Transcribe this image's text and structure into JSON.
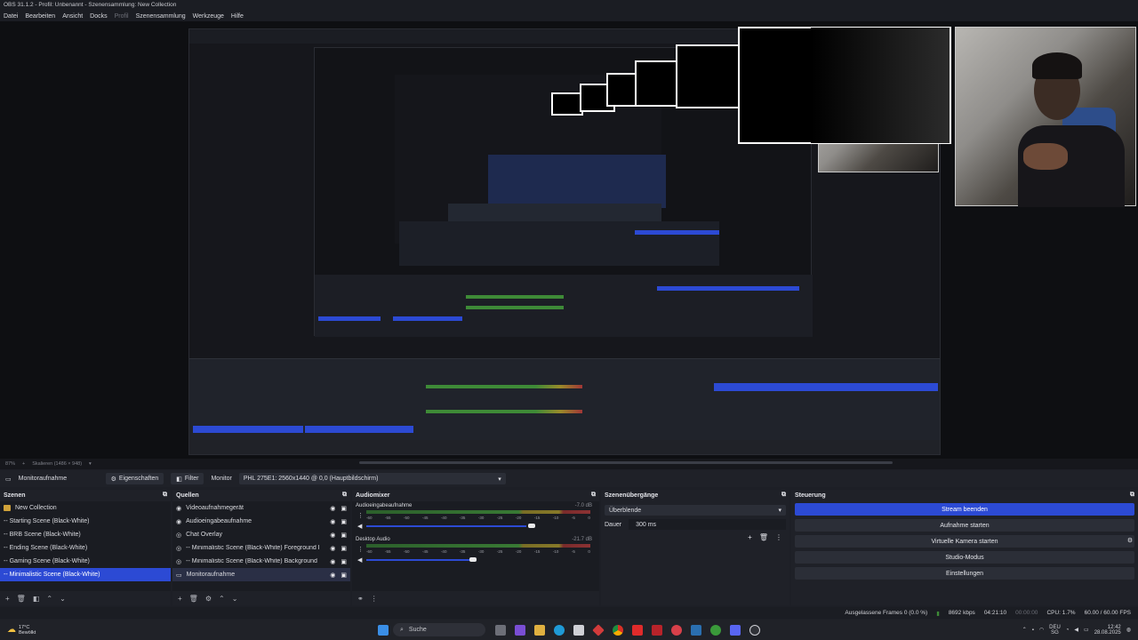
{
  "window": {
    "title": "OBS 31.1.2 - Profil: Unbenannt - Szenensammlung: New Collection"
  },
  "menu": {
    "items": [
      {
        "label": "Datei"
      },
      {
        "label": "Bearbeiten"
      },
      {
        "label": "Ansicht"
      },
      {
        "label": "Docks"
      },
      {
        "label": "Profil",
        "disabled": true
      },
      {
        "label": "Szenensammlung"
      },
      {
        "label": "Werkzeuge"
      },
      {
        "label": "Hilfe"
      }
    ]
  },
  "preview_status": {
    "zoom": "87%",
    "scale": "Skalieren (1486 × 948)"
  },
  "context_bar": {
    "source_name": "Monitoraufnahme",
    "properties_label": "Eigenschaften",
    "filter_label": "Filter",
    "monitor_label": "Monitor",
    "monitor_value": "PHL 275E1: 2560x1440 @ 0,0 (Hauptbildschirm)"
  },
  "scenes": {
    "title": "Szenen",
    "items": [
      {
        "label": "New Collection",
        "folder": true
      },
      {
        "label": "-- Starting Scene (Black-White)"
      },
      {
        "label": "-- BRB Scene (Black-White)"
      },
      {
        "label": "-- Ending Scene (Black-White)"
      },
      {
        "label": "-- Gaming Scene (Black-White)"
      },
      {
        "label": "-- Minimalistic Scene (Black-White)",
        "selected": true
      }
    ]
  },
  "sources": {
    "title": "Quellen",
    "items": [
      {
        "label": "Videoaufnahmegerät",
        "icon": "camera-icon"
      },
      {
        "label": "Audioeingabeaufnahme",
        "icon": "mic-icon"
      },
      {
        "label": "Chat Overlay",
        "icon": "browser-icon"
      },
      {
        "label": "-- Minimalistic Scene (Black-White)  Foreground Bro",
        "icon": "browser-icon"
      },
      {
        "label": "-- Minimalistic Scene (Black-White)  Background Bro",
        "icon": "browser-icon"
      },
      {
        "label": "Monitoraufnahme",
        "icon": "monitor-icon",
        "selected": true
      }
    ]
  },
  "mixer": {
    "title": "Audiomixer",
    "ticks": [
      "-60",
      "-55",
      "-50",
      "-45",
      "-40",
      "-35",
      "-30",
      "-25",
      "-20",
      "-15",
      "-10",
      "-5",
      "0"
    ],
    "channels": [
      {
        "name": "Audioeingabeaufnahme",
        "db": "-7.0 dB",
        "volume": 0.8
      },
      {
        "name": "Desktop Audio",
        "db": "-21.7 dB",
        "volume": 0.5
      }
    ]
  },
  "transitions": {
    "title": "Szenenübergänge",
    "selected": "Überblende",
    "duration_label": "Dauer",
    "duration_value": "300 ms"
  },
  "controls": {
    "title": "Steuerung",
    "buttons": [
      {
        "label": "Stream beenden",
        "active": true
      },
      {
        "label": "Aufnahme starten"
      },
      {
        "label": "Virtuelle Kamera starten"
      },
      {
        "label": "Studio-Modus"
      },
      {
        "label": "Einstellungen"
      }
    ]
  },
  "statusbar": {
    "dropped_frames": "Ausgelassene Frames 0 (0.0 %)",
    "bitrate": "8692 kbps",
    "stream_time": "04:21:10",
    "rec_time": "00:00:00",
    "cpu": "CPU: 1.7%",
    "fps": "60.00 / 60.00 FPS"
  },
  "taskbar": {
    "weather_temp": "17°C",
    "weather_desc": "Bewölkt",
    "search_label": "Suche",
    "lang": "DEU",
    "region": "SG",
    "time": "12:42",
    "date": "28.08.2025"
  },
  "colors": {
    "accent": "#2c4ad4",
    "panel": "#1f2128",
    "background": "#1d1f26"
  }
}
